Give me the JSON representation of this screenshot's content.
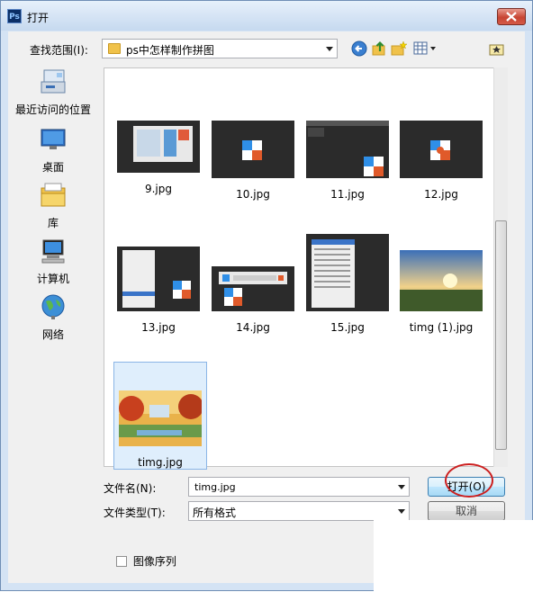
{
  "window": {
    "title": "打开"
  },
  "toolbar": {
    "look_in_label": "查找范围(I):",
    "look_in_value": "ps中怎样制作拼图",
    "back_icon": "back-arrow-icon",
    "up_icon": "up-folder-icon",
    "new_folder_icon": "new-folder-icon",
    "views_icon": "view-menu-icon",
    "extra_icon": "star-icon"
  },
  "places": [
    {
      "label": "最近访问的位置",
      "icon": "recent-places-icon"
    },
    {
      "label": "桌面",
      "icon": "desktop-icon"
    },
    {
      "label": "库",
      "icon": "libraries-icon"
    },
    {
      "label": "计算机",
      "icon": "computer-icon"
    },
    {
      "label": "网络",
      "icon": "network-icon"
    }
  ],
  "files": [
    {
      "name": "9.jpg"
    },
    {
      "name": "10.jpg"
    },
    {
      "name": "11.jpg"
    },
    {
      "name": "12.jpg"
    },
    {
      "name": "13.jpg"
    },
    {
      "name": "14.jpg"
    },
    {
      "name": "15.jpg"
    },
    {
      "name": "timg (1).jpg"
    },
    {
      "name": "timg.jpg",
      "selected": true
    }
  ],
  "form": {
    "file_name_label": "文件名(N):",
    "file_name_value": "timg.jpg",
    "file_type_label": "文件类型(T):",
    "file_type_value": "所有格式",
    "open_button": "打开(O)",
    "cancel_button": "取消",
    "sequence_checkbox": "图像序列",
    "sequence_checked": false
  },
  "colors": {
    "accent": "#3c7fb1",
    "annotation": "#cc1f1f"
  }
}
